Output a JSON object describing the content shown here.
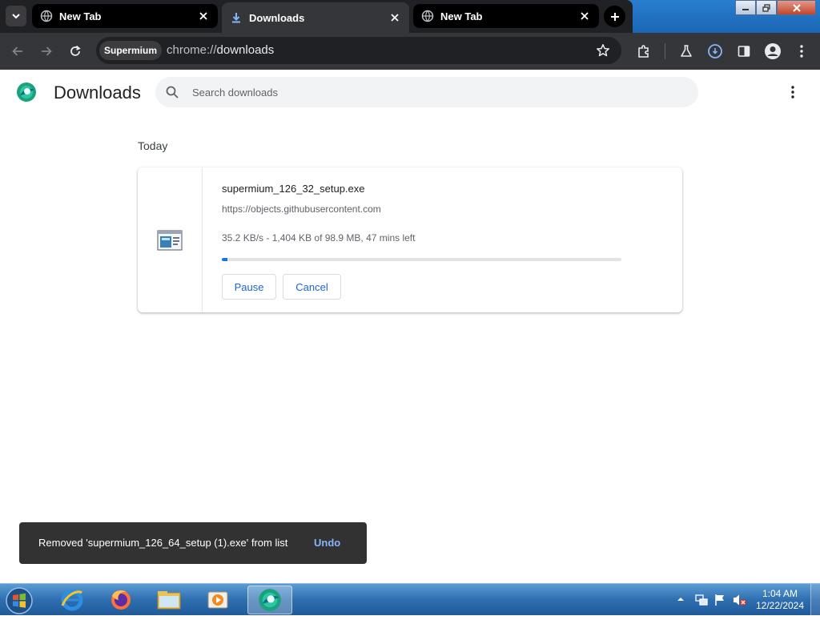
{
  "tabs": [
    {
      "title": "New Tab",
      "active": false
    },
    {
      "title": "Downloads",
      "active": true
    },
    {
      "title": "New Tab",
      "active": false
    }
  ],
  "toolbar": {
    "chip_label": "Supermium",
    "url_scheme": "chrome://",
    "url_host": "downloads"
  },
  "page": {
    "title": "Downloads",
    "search_placeholder": "Search downloads",
    "date_group": "Today"
  },
  "download": {
    "filename": "supermium_126_32_setup.exe",
    "source_url": "https://objects.githubusercontent.com",
    "status": "35.2 KB/s - 1,404 KB of 98.9 MB, 47 mins left",
    "progress_fraction": 0.014,
    "pause_label": "Pause",
    "cancel_label": "Cancel"
  },
  "toast": {
    "message": "Removed 'supermium_126_64_setup (1).exe' from list",
    "undo_label": "Undo"
  },
  "taskbar": {
    "apps": [
      "start-orb",
      "internet-explorer",
      "firefox",
      "file-explorer",
      "media-player",
      "supermium"
    ],
    "clock_time": "1:04 AM",
    "clock_date": "12/22/2024"
  },
  "colors": {
    "accent": "#1a73e8",
    "tabstrip_dark": "#202124",
    "toolbar": "#35363a",
    "toast_bg": "#323232",
    "undo_link": "#8ab4f8"
  }
}
